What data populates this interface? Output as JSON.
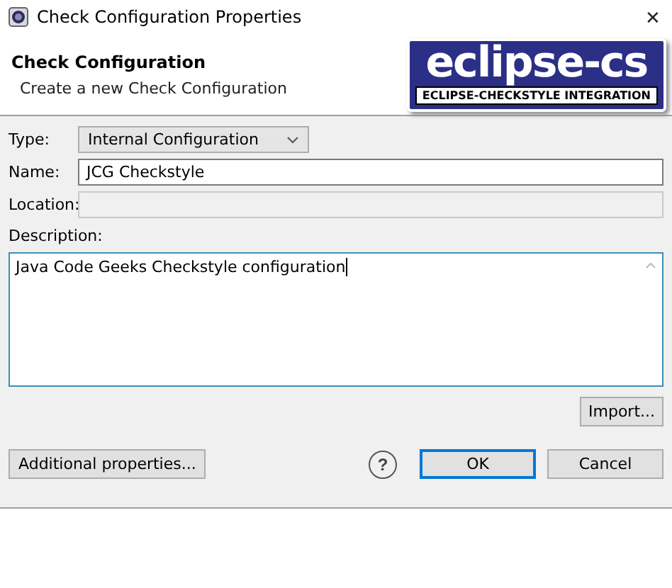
{
  "window": {
    "title": "Check Configuration Properties",
    "close": "✕"
  },
  "header": {
    "title": "Check Configuration",
    "subtitle": "Create a new Check Configuration",
    "logo": {
      "name": "eclipse-cs",
      "tagline": "ECLIPSE-CHECKSTYLE INTEGRATION"
    }
  },
  "fields": [
    {
      "kind": "dropdown",
      "label": "Type:",
      "value": "Internal Configuration"
    },
    {
      "kind": "text",
      "label": "Name:",
      "value": "JCG Checkstyle",
      "disabled": false
    },
    {
      "kind": "text",
      "label": "Location:",
      "disabled": true
    }
  ],
  "description": {
    "label": "Description:",
    "value": "Java Code Geeks Checkstyle configuration",
    "focused": true
  },
  "import_button": "Import...",
  "buttons": [
    {
      "label": "Additional properties...",
      "default": false
    },
    {
      "label": "OK",
      "default": true
    },
    {
      "label": "Cancel",
      "default": false
    }
  ],
  "help": "?"
}
